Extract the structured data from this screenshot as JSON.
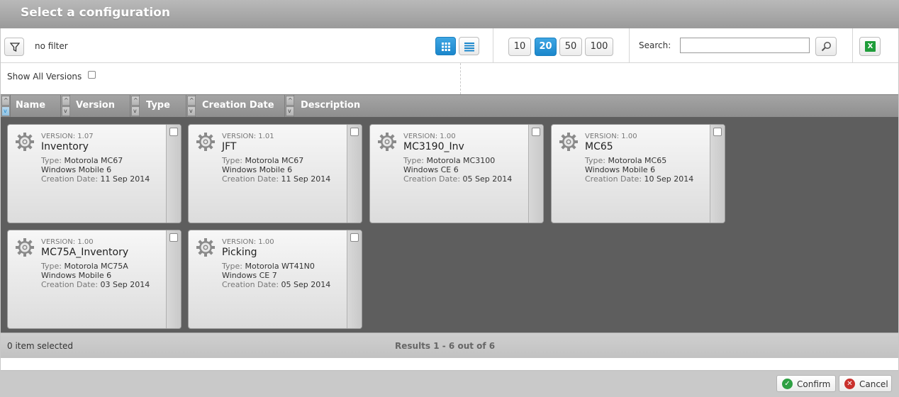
{
  "window": {
    "title": "Select a configuration"
  },
  "toolbar": {
    "filter_label": "no filter",
    "page_sizes": [
      "10",
      "20",
      "50",
      "100"
    ],
    "active_page_size": "20",
    "search_label": "Search:",
    "search_value": "",
    "export_icon": "excel-icon",
    "view_modes": [
      "grid-view-icon",
      "list-view-icon"
    ],
    "active_view": "grid-view-icon"
  },
  "options": {
    "show_all_versions_label": "Show All Versions",
    "show_all_versions_checked": false
  },
  "columns": [
    "Name",
    "Version",
    "Type",
    "Creation Date",
    "Description"
  ],
  "cards": [
    {
      "version": "VERSION: 1.07",
      "name": "Inventory",
      "type_label": "Type:",
      "type_value": "Motorola MC67",
      "os": "Windows Mobile 6",
      "date_label": "Creation Date:",
      "date_value": "11 Sep 2014"
    },
    {
      "version": "VERSION: 1.01",
      "name": "JFT",
      "type_label": "Type:",
      "type_value": "Motorola MC67",
      "os": "Windows Mobile 6",
      "date_label": "Creation Date:",
      "date_value": "11 Sep 2014"
    },
    {
      "version": "VERSION: 1.00",
      "name": "MC3190_Inv",
      "type_label": "Type:",
      "type_value": "Motorola MC3100",
      "os": "Windows CE 6",
      "date_label": "Creation Date:",
      "date_value": "05 Sep 2014"
    },
    {
      "version": "VERSION: 1.00",
      "name": "MC65",
      "type_label": "Type:",
      "type_value": "Motorola MC65",
      "os": "Windows Mobile 6",
      "date_label": "Creation Date:",
      "date_value": "10 Sep 2014"
    },
    {
      "version": "VERSION: 1.00",
      "name": "MC75A_Inventory",
      "type_label": "Type:",
      "type_value": "Motorola MC75A",
      "os": "Windows Mobile 6",
      "date_label": "Creation Date:",
      "date_value": "03 Sep 2014"
    },
    {
      "version": "VERSION: 1.00",
      "name": "Picking",
      "type_label": "Type:",
      "type_value": "Motorola WT41N0",
      "os": "Windows CE 7",
      "date_label": "Creation Date:",
      "date_value": "05 Sep 2014"
    }
  ],
  "status": {
    "selected": "0 item selected",
    "results": "Results 1 - 6 out of 6"
  },
  "footer": {
    "confirm_label": "Confirm",
    "cancel_label": "Cancel"
  },
  "colors": {
    "accent": "#1b87cc",
    "confirm": "#2ea043",
    "cancel": "#c9302c"
  }
}
